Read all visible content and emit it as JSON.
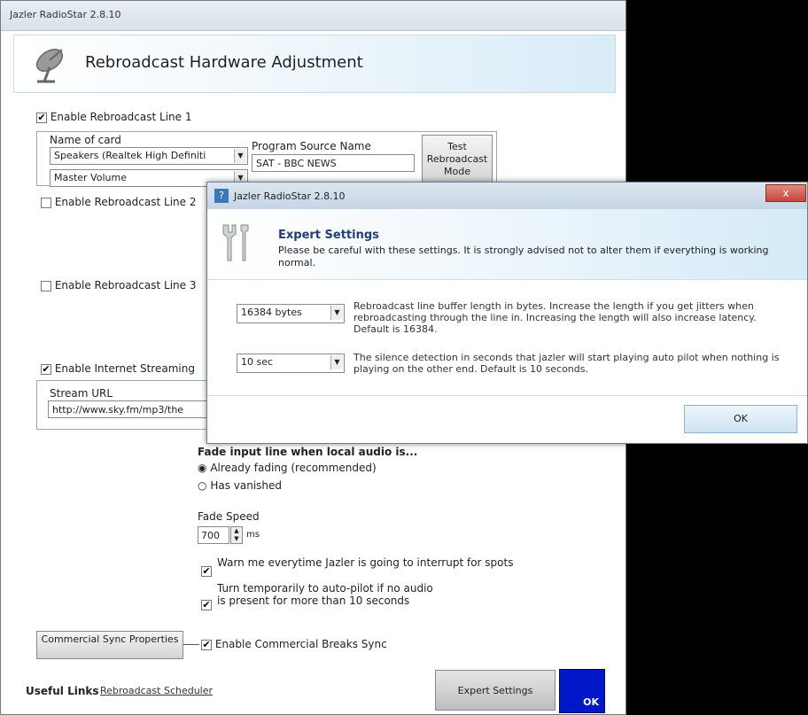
{
  "main_window": {
    "title": "Jazler RadioStar 2.8.10",
    "header_title": "Rebroadcast Hardware Adjustment",
    "icon": "satellite-dish-icon"
  },
  "line1": {
    "label": "Enable Rebroadcast Line 1",
    "checked": "✔",
    "name_of_card_label": "Name of card",
    "card_value": "Speakers (Realtek High Definiti",
    "volume_value": "Master Volume",
    "program_source_label": "Program Source Name",
    "program_source_value": "SAT - BBC NEWS",
    "test_button": "Test Rebroadcast Mode"
  },
  "line2": {
    "label": "Enable Rebroadcast Line 2",
    "checked": ""
  },
  "line3": {
    "label": "Enable Rebroadcast Line 3",
    "checked": ""
  },
  "streaming": {
    "label": "Enable Internet Streaming",
    "checked": "✔",
    "stream_url_label": "Stream URL",
    "stream_url_value": "http://www.sky.fm/mp3/the"
  },
  "fade": {
    "heading": "Fade input line when local audio is...",
    "option1": "Already fading (recommended)",
    "option2": "Has vanished",
    "speed_label": "Fade Speed",
    "speed_value": "700",
    "speed_unit": "ms"
  },
  "options": {
    "warn_label": "Warn me everytime Jazler is going to interrupt for spots",
    "warn_checked": "✔",
    "autopilot_label": "Turn temporarily to auto-pilot if no audio is present for more than 10 seconds",
    "autopilot_checked": "✔",
    "commercial_sync_label": "Enable Commercial Breaks Sync",
    "commercial_sync_checked": "✔"
  },
  "buttons": {
    "commercial_sync_properties": "Commercial Sync Properties",
    "expert_settings": "Expert Settings",
    "ok": "OK"
  },
  "footer": {
    "useful_links": "Useful Links",
    "scheduler_link": "Rebroadcast Scheduler"
  },
  "dialog": {
    "title": "Jazler RadioStar 2.8.10",
    "close": "x",
    "heading": "Expert Settings",
    "description": "Please be careful with these settings. It is strongly advised not to alter them if everything is working normal.",
    "buffer_value": "16384 bytes",
    "buffer_desc": "Rebroadcast line buffer length in bytes. Increase the length if you get jitters when rebroadcasting through the line in. Increasing the length will also increase latency. Default is 16384.",
    "silence_value": "10 sec",
    "silence_desc": "The silence detection in seconds that jazler will start playing auto pilot when nothing is playing on the other end. Default is 10 seconds.",
    "ok": "OK"
  }
}
